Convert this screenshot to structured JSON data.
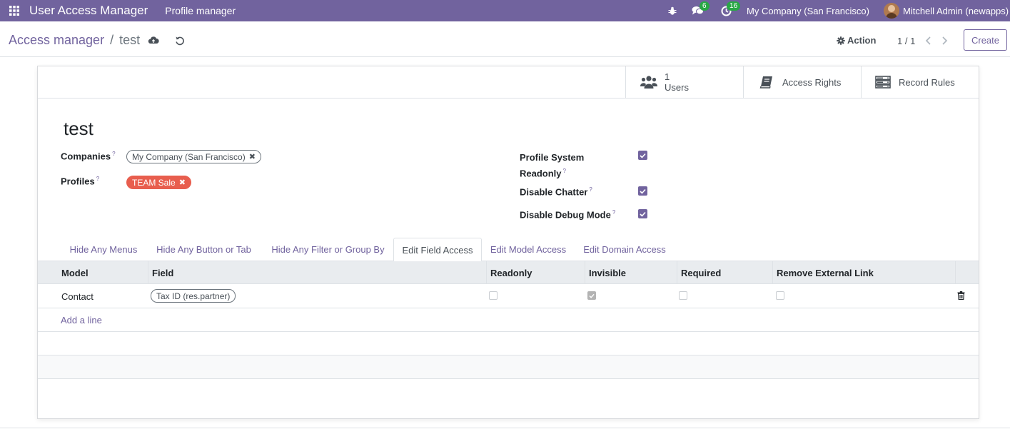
{
  "navbar": {
    "app_title": "User Access Manager",
    "menu": "Profile manager",
    "messages_count": "6",
    "activities_count": "16",
    "company": "My Company (San Francisco)",
    "user": "Mitchell Admin (newapps)"
  },
  "breadcrumb": {
    "parent": "Access manager",
    "separator": "/",
    "current": "test"
  },
  "control": {
    "action_label": "Action",
    "pager": "1 / 1",
    "create_label": "Create"
  },
  "stat_buttons": {
    "users_count": "1",
    "users_label": "Users",
    "access_rights": "Access Rights",
    "record_rules": "Record Rules"
  },
  "record": {
    "name": "test",
    "companies_label": "Companies",
    "companies_tag": "My Company (San Francisco)",
    "profiles_label": "Profiles",
    "profiles_tag": "TEAM Sale",
    "help_mark": "?",
    "profile_readonly_label_1": "Profile System",
    "profile_readonly_label_2": "Readonly",
    "profile_readonly": true,
    "disable_chatter_label": "Disable Chatter",
    "disable_chatter": true,
    "disable_debug_label": "Disable Debug Mode",
    "disable_debug": true
  },
  "tabs": [
    {
      "label": "Hide Any Menus",
      "active": false
    },
    {
      "label": "Hide Any Button or Tab",
      "active": false
    },
    {
      "label": "Hide Any Filter or Group By",
      "active": false
    },
    {
      "label": "Edit Field Access",
      "active": true
    },
    {
      "label": "Edit Model Access",
      "active": false
    },
    {
      "label": "Edit Domain Access",
      "active": false
    }
  ],
  "table": {
    "columns": [
      "Model",
      "Field",
      "Readonly",
      "Invisible",
      "Required",
      "Remove External Link"
    ],
    "rows": [
      {
        "model": "Contact",
        "field": "Tax ID (res.partner)",
        "readonly": false,
        "invisible": true,
        "required": false,
        "remove_external_link": false
      }
    ],
    "add_line": "Add a line"
  },
  "colors": {
    "brand": "#71639e",
    "badge": "#28a745",
    "tag_red": "#e85e4e"
  }
}
